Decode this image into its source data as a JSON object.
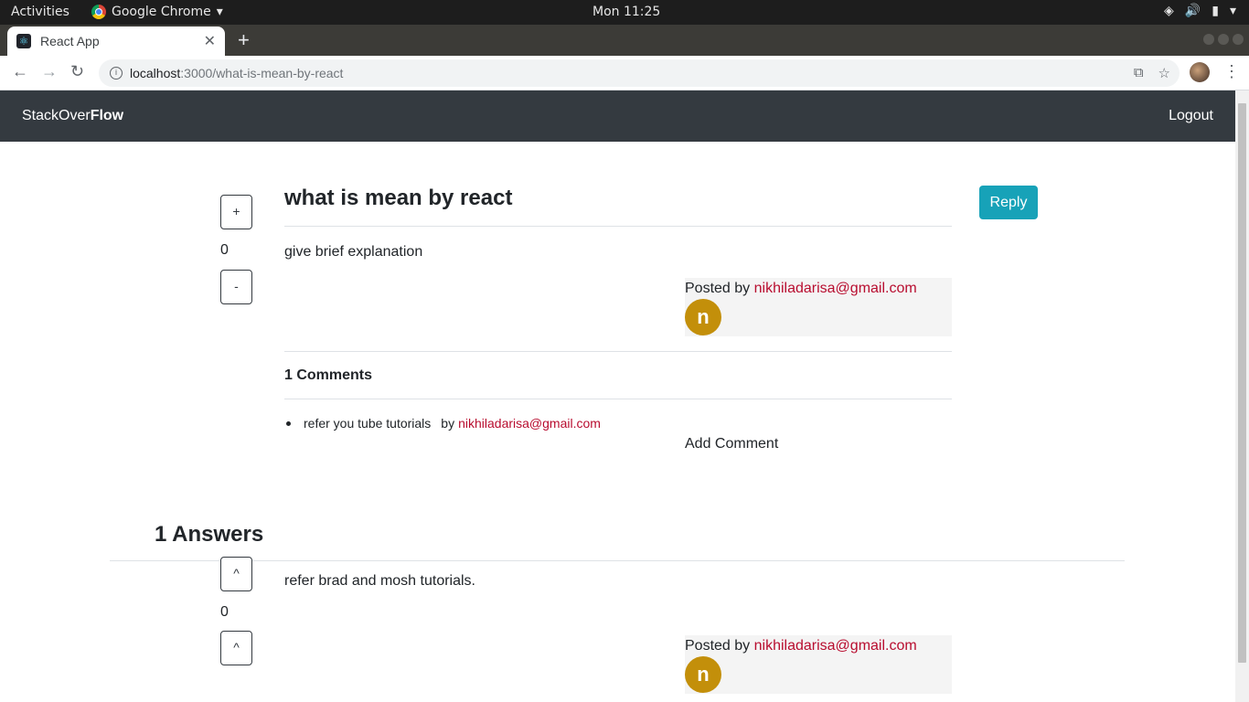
{
  "os_bar": {
    "activities": "Activities",
    "app_name": "Google Chrome",
    "clock": "Mon 11:25"
  },
  "browser": {
    "tab_title": "React App",
    "url_host": "localhost",
    "url_path": ":3000/what-is-mean-by-react"
  },
  "navbar": {
    "brand_light": "StackOver",
    "brand_bold": "Flow",
    "logout": "Logout"
  },
  "question": {
    "vote_up": "+",
    "vote_down": "-",
    "votes": "0",
    "title": "what is mean by react",
    "reply": "Reply",
    "body": "give brief explanation",
    "posted_by_label": "Posted by",
    "author": "nikhiladarisa@gmail.com",
    "avatar_letter": "n"
  },
  "comments": {
    "title": "1 Comments",
    "items": [
      {
        "text": "refer you tube tutorials",
        "by": "by",
        "author": "nikhiladarisa@gmail.com"
      }
    ],
    "add_comment": "Add Comment"
  },
  "answers": {
    "title": "1 Answers",
    "items": [
      {
        "vote_up": "^",
        "vote_down": "^",
        "votes": "0",
        "body": "refer brad and mosh tutorials.",
        "posted_by_label": "Posted by",
        "author": "nikhiladarisa@gmail.com",
        "avatar_letter": "n"
      }
    ]
  },
  "colors": {
    "navbar": "#343a40",
    "reply_button": "#17a2b8",
    "author_link": "#b80d2f",
    "avatar": "#c38f0a"
  }
}
